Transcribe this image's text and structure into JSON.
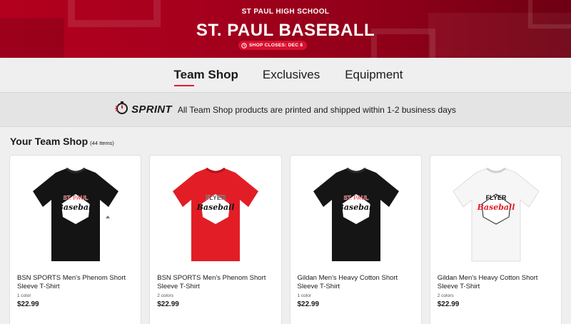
{
  "hero": {
    "school": "ST PAUL HIGH SCHOOL",
    "title": "ST. PAUL BASEBALL",
    "badge": "SHOP CLOSES: DEC 8"
  },
  "nav": {
    "tabs": [
      {
        "label": "Team Shop",
        "active": true
      },
      {
        "label": "Exclusives",
        "active": false
      },
      {
        "label": "Equipment",
        "active": false
      }
    ]
  },
  "sprint": {
    "logo_text": "SPRINT",
    "message": "All Team Shop products are printed and shipped within 1-2 business days"
  },
  "shop": {
    "title": "Your Team Shop",
    "count": "(44 Items)"
  },
  "products": [
    {
      "name": "BSN SPORTS Men's Phenom Short Sleeve T-Shirt",
      "colors": "1 color",
      "price": "$22.99",
      "shirt_color": "#141414",
      "print_top": "ST. PAUL",
      "print_script": "Baseball"
    },
    {
      "name": "BSN SPORTS Men's Phenom Short Sleeve T-Shirt",
      "colors": "2 colors",
      "price": "$22.99",
      "shirt_color": "#e21d26",
      "print_top": "FLYER",
      "print_script": "Baseball"
    },
    {
      "name": "Gildan Men's Heavy Cotton Short Sleeve T-Shirt",
      "colors": "1 color",
      "price": "$22.99",
      "shirt_color": "#151515",
      "print_top": "ST. PAUL",
      "print_script": "Baseball"
    },
    {
      "name": "Gildan Men's Heavy Cotton Short Sleeve T-Shirt",
      "colors": "2 colors",
      "price": "$22.99",
      "shirt_color": "#f6f6f6",
      "print_top": "FLYER",
      "print_script": "Baseball"
    }
  ],
  "colors": {
    "brand_red": "#b3001f",
    "accent": "#e11a37"
  }
}
